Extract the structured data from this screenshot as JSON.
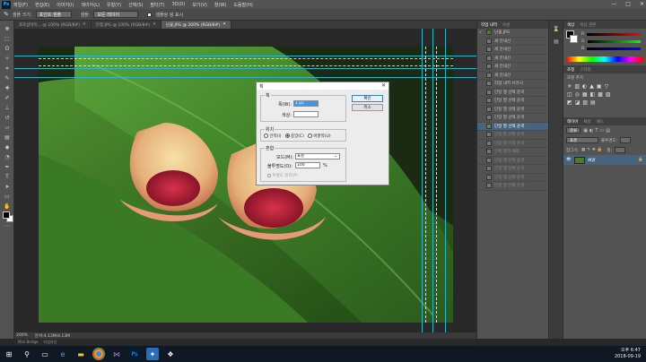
{
  "menubar": {
    "logo": "Ps",
    "items": [
      "파일(F)",
      "편집(E)",
      "이미지(I)",
      "레이어(L)",
      "유형(Y)",
      "선택(S)",
      "필터(T)",
      "3D(D)",
      "보기(V)",
      "창(W)",
      "도움말(H)"
    ],
    "window_buttons": [
      "—",
      "□",
      "✕"
    ]
  },
  "options": {
    "style_label": "샘플 크기:",
    "style_value": "포인트 샘플",
    "sample_label": "샘플:",
    "sample_value": "모든 레이어",
    "ring_label": "샘플링 링 표시"
  },
  "tabs": [
    {
      "label": "포토샵아이... @ 100% (RGB/8#)"
    },
    {
      "label": "단청.JPG @ 100% (RGB/8#)"
    },
    {
      "label": "난꽃.JPG @ 200% (RGB/8#)"
    }
  ],
  "status": {
    "zoom": "200%",
    "doc": "문서:4.13M/4.13M"
  },
  "bottom_tabs": [
    "Mini Bridge",
    "타임라인"
  ],
  "history": {
    "tabs": [
      "작업 내역",
      "속성"
    ],
    "snapshot": "난꽃.JPG",
    "items": [
      {
        "label": "새 안내선",
        "state": "normal"
      },
      {
        "label": "새 안내선",
        "state": "normal"
      },
      {
        "label": "새 안내선",
        "state": "normal"
      },
      {
        "label": "새 안내선",
        "state": "normal"
      },
      {
        "label": "새 안내선",
        "state": "normal"
      },
      {
        "label": "작업 내역 브러시",
        "state": "normal"
      },
      {
        "label": "단일 행 선택 윤곽",
        "state": "normal"
      },
      {
        "label": "단일 행 선택 윤곽",
        "state": "normal"
      },
      {
        "label": "단일 행 선택 윤곽",
        "state": "normal"
      },
      {
        "label": "단일 열 선택 윤곽",
        "state": "normal"
      },
      {
        "label": "단일 열 선택 윤곽",
        "state": "selected"
      },
      {
        "label": "단일 열 선택 윤곽",
        "state": "dim"
      },
      {
        "label": "단일 열 선택 윤곽",
        "state": "dim"
      },
      {
        "label": "선택 영역 해제",
        "state": "dim"
      },
      {
        "label": "단일 행 선택 윤곽",
        "state": "dim"
      },
      {
        "label": "단일 행 선택 윤곽",
        "state": "dim"
      },
      {
        "label": "단일 행 선택 윤곽",
        "state": "dim"
      },
      {
        "label": "단일 행 선택 윤곽",
        "state": "dim"
      }
    ]
  },
  "right": {
    "color_tabs": [
      "색상",
      "색상 견본"
    ],
    "rgb_labels": [
      "R",
      "G",
      "B"
    ],
    "adjust_tabs": [
      "조정",
      "스타일"
    ],
    "adjust_title": "조정 추가",
    "layers_tabs": [
      "레이어",
      "채널",
      "패스"
    ],
    "kind_label": "종류",
    "blend": "표준",
    "opacity_label": "불투명도:",
    "lock_label": "잠그기:",
    "fill_label": "칠:",
    "layer_name": "배경"
  },
  "dialog": {
    "title": "획",
    "close": "✕",
    "group_stroke": "획",
    "width_label": "폭(W):",
    "width_value": "1 px",
    "color_label": "색상:",
    "ok": "확인",
    "cancel": "취소",
    "group_position": "위치",
    "pos_options": [
      "안쪽(I)",
      "중앙(C)",
      "바깥쪽(U)"
    ],
    "pos_selected": 1,
    "group_blend": "혼합",
    "mode_label": "모드(M):",
    "mode_value": "표준",
    "opacity_label": "불투명도(O):",
    "opacity_value": "100",
    "opacity_unit": "%",
    "preserve_label": "투명도 유지(P)"
  },
  "taskbar": {
    "time": "오후 6:47",
    "date": "2018-09-19"
  },
  "colors": {
    "accent": "#46637f",
    "guide": "#27b7c8",
    "photo_green": "#3f7d2a"
  }
}
